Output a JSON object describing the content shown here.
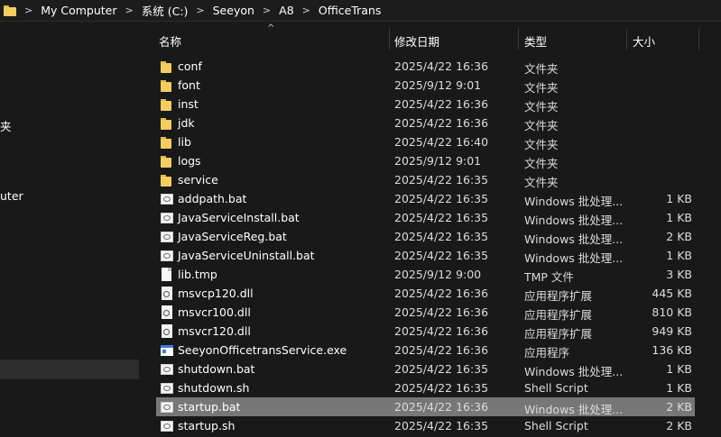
{
  "breadcrumb": [
    "My Computer",
    "系统 (C:)",
    "Seeyon",
    "A8",
    "OfficeTrans"
  ],
  "nav": {
    "partial_1": "夹",
    "partial_2": "uter"
  },
  "columns": {
    "name": "名称",
    "date": "修改日期",
    "type": "类型",
    "size": "大小"
  },
  "files": [
    {
      "name": "conf",
      "date": "2025/4/22 16:36",
      "type": "文件夹",
      "size": "",
      "icon": "folder"
    },
    {
      "name": "font",
      "date": "2025/9/12 9:01",
      "type": "文件夹",
      "size": "",
      "icon": "folder"
    },
    {
      "name": "inst",
      "date": "2025/4/22 16:36",
      "type": "文件夹",
      "size": "",
      "icon": "folder"
    },
    {
      "name": "jdk",
      "date": "2025/4/22 16:36",
      "type": "文件夹",
      "size": "",
      "icon": "folder"
    },
    {
      "name": "lib",
      "date": "2025/4/22 16:40",
      "type": "文件夹",
      "size": "",
      "icon": "folder"
    },
    {
      "name": "logs",
      "date": "2025/9/12 9:01",
      "type": "文件夹",
      "size": "",
      "icon": "folder"
    },
    {
      "name": "service",
      "date": "2025/4/22 16:35",
      "type": "文件夹",
      "size": "",
      "icon": "folder"
    },
    {
      "name": "addpath.bat",
      "date": "2025/4/22 16:35",
      "type": "Windows 批处理...",
      "size": "1 KB",
      "icon": "bat"
    },
    {
      "name": "JavaServiceInstall.bat",
      "date": "2025/4/22 16:35",
      "type": "Windows 批处理...",
      "size": "1 KB",
      "icon": "bat"
    },
    {
      "name": "JavaServiceReg.bat",
      "date": "2025/4/22 16:35",
      "type": "Windows 批处理...",
      "size": "2 KB",
      "icon": "bat"
    },
    {
      "name": "JavaServiceUninstall.bat",
      "date": "2025/4/22 16:35",
      "type": "Windows 批处理...",
      "size": "1 KB",
      "icon": "bat"
    },
    {
      "name": "lib.tmp",
      "date": "2025/9/12 9:00",
      "type": "TMP 文件",
      "size": "3 KB",
      "icon": "tmp"
    },
    {
      "name": "msvcp120.dll",
      "date": "2025/4/22 16:36",
      "type": "应用程序扩展",
      "size": "445 KB",
      "icon": "dll"
    },
    {
      "name": "msvcr100.dll",
      "date": "2025/4/22 16:36",
      "type": "应用程序扩展",
      "size": "810 KB",
      "icon": "dll"
    },
    {
      "name": "msvcr120.dll",
      "date": "2025/4/22 16:36",
      "type": "应用程序扩展",
      "size": "949 KB",
      "icon": "dll"
    },
    {
      "name": "SeeyonOfficetransService.exe",
      "date": "2025/4/22 16:36",
      "type": "应用程序",
      "size": "136 KB",
      "icon": "exe"
    },
    {
      "name": "shutdown.bat",
      "date": "2025/4/22 16:35",
      "type": "Windows 批处理...",
      "size": "1 KB",
      "icon": "bat"
    },
    {
      "name": "shutdown.sh",
      "date": "2025/4/22 16:35",
      "type": "Shell Script",
      "size": "1 KB",
      "icon": "bat"
    },
    {
      "name": "startup.bat",
      "date": "2025/4/22 16:36",
      "type": "Windows 批处理...",
      "size": "2 KB",
      "icon": "bat",
      "selected": true
    },
    {
      "name": "startup.sh",
      "date": "2025/4/22 16:35",
      "type": "Shell Script",
      "size": "2 KB",
      "icon": "bat"
    }
  ],
  "colors": {
    "background": "#191919",
    "selected_row": "#777777",
    "folder": "#f3cd5d"
  }
}
